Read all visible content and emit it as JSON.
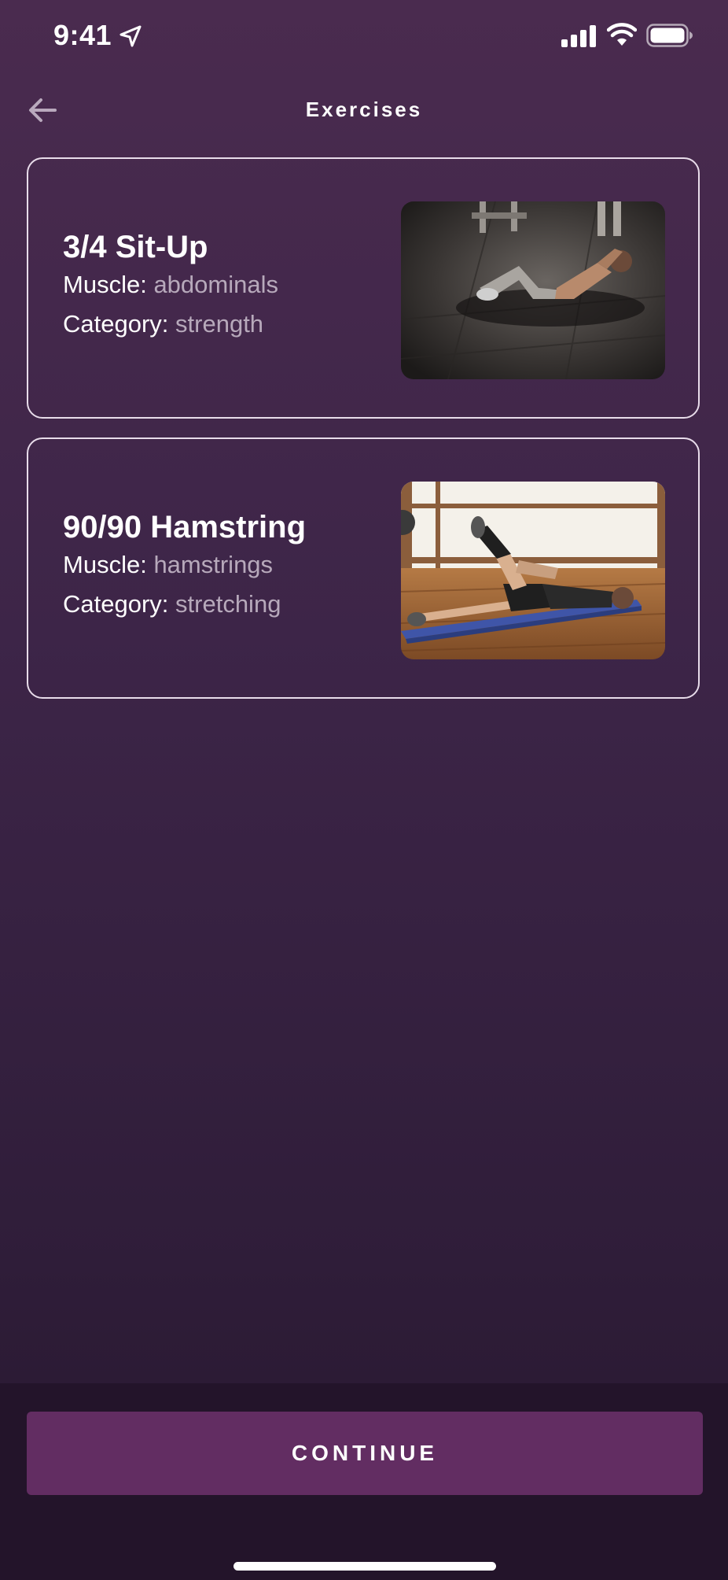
{
  "status_bar": {
    "time": "9:41",
    "icons": [
      "location-arrow-icon",
      "cellular-signal-icon",
      "wifi-icon",
      "battery-icon"
    ]
  },
  "header": {
    "title": "Exercises",
    "back_icon": "arrow-left-icon"
  },
  "exercises": [
    {
      "title": "3/4 Sit-Up",
      "muscle_label": "Muscle:",
      "muscle": "abdominals",
      "category_label": "Category:",
      "category": "strength",
      "image_description": "man doing sit-up on gym floor"
    },
    {
      "title": "90/90 Hamstring",
      "muscle_label": "Muscle:",
      "muscle": "hamstrings",
      "category_label": "Category:",
      "category": "stretching",
      "image_description": "man lying on blue mat stretching leg"
    }
  ],
  "footer": {
    "continue_label": "CONTINUE"
  },
  "colors": {
    "background_top": "#4a2b4f",
    "background_bottom": "#27172e",
    "button": "#622d62",
    "muted_text": "#b7a9bb",
    "card_border": "#e8dcea"
  }
}
